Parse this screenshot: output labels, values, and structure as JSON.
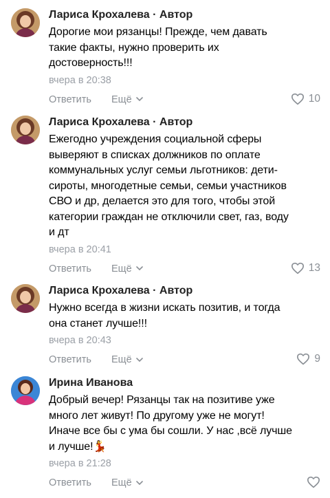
{
  "ui": {
    "separator": "·",
    "reply_label": "Ответить",
    "more_label": "Ещё"
  },
  "comments": [
    {
      "author": "Лариса Крохалева",
      "role": "Автор",
      "text": "Дорогие мои рязанцы! Прежде, чем давать\nтакие факты, нужно проверить их\nдостоверность!!!",
      "time": "вчера в 20:38",
      "likes": "10",
      "avatar_icon": "woman-portrait-avatar"
    },
    {
      "author": "Лариса Крохалева",
      "role": "Автор",
      "text": "Ежегодно учреждения социальной сферы\nвыверяют в списках должников по оплате\nкоммунальных услуг семьи льготников: дети-\nсироты, многодетные семьи, семьи участников\nСВО и др, делается это для того, чтобы этой\nкатегории граждан не отключили свет, газ, воду\nи дт",
      "time": "вчера в 20:41",
      "likes": "13",
      "avatar_icon": "woman-portrait-avatar"
    },
    {
      "author": "Лариса Крохалева",
      "role": "Автор",
      "text": "Нужно всегда в жизни искать позитив, и тогда\nона станет лучше!!!",
      "time": "вчера в 20:43",
      "likes": "9",
      "avatar_icon": "woman-portrait-avatar"
    },
    {
      "author": "Ирина Иванова",
      "text": "Добрый вечер! Рязанцы так на позитиве уже\nмного лет живут! По другому уже не могут!\nИначе все бы с ума бы сошли. У нас ,всё лучше\nи лучше!💃",
      "time": "вчера в 21:28",
      "avatar_icon": "woman-blue-background-avatar"
    }
  ],
  "colors": {
    "author": "#222222",
    "meta": "#9a9fa6",
    "action": "#8a8f95"
  }
}
